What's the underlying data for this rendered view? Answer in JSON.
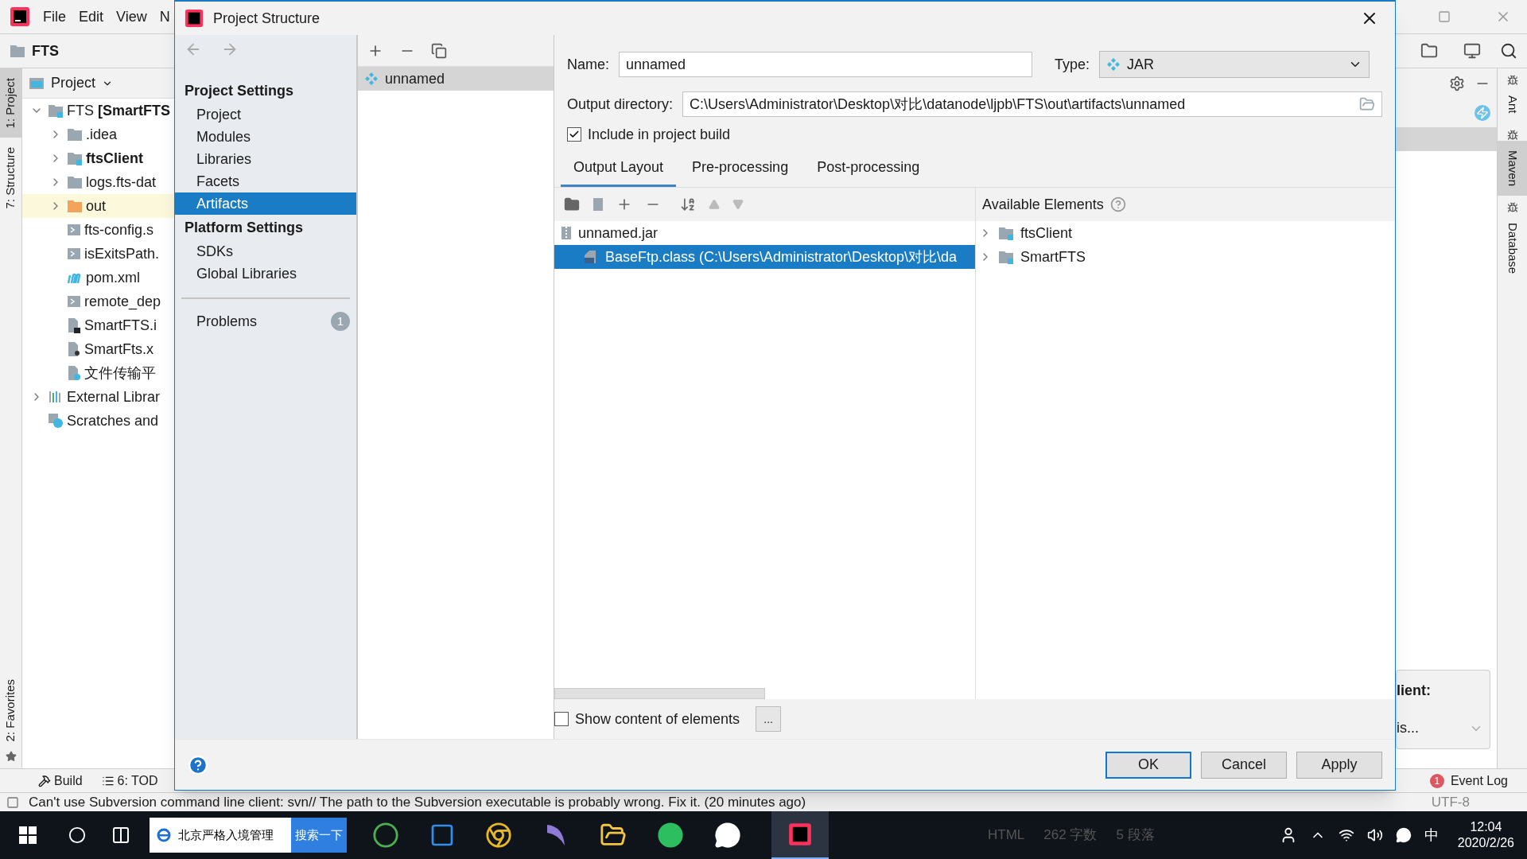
{
  "ide": {
    "menu": [
      "File",
      "Edit",
      "View",
      "N"
    ],
    "breadcrumb": "FTS",
    "left_stripe": [
      {
        "label": "1: Project",
        "selected": true
      },
      {
        "label": "7: Structure",
        "selected": false
      }
    ],
    "left_stripe_bottom": [
      {
        "label": "2: Favorites",
        "selected": false
      }
    ],
    "project_panel": {
      "title": "Project",
      "tree": [
        {
          "label": "FTS **[SmartFTS**",
          "kind": "module-folder",
          "expanded": true,
          "highlighted": false,
          "bold": false,
          "children": [
            {
              "label": ".idea",
              "kind": "folder",
              "expanded": false,
              "highlighted": false,
              "bold": false
            },
            {
              "label": "ftsClient",
              "kind": "module-folder",
              "expanded": false,
              "highlighted": false,
              "bold": true
            },
            {
              "label": "logs.fts-dat",
              "kind": "folder",
              "expanded": false,
              "highlighted": false,
              "bold": false
            },
            {
              "label": "out",
              "kind": "excluded-folder",
              "expanded": false,
              "highlighted": true,
              "bold": false
            },
            {
              "label": "fts-config.s",
              "kind": "text-file",
              "highlighted": false,
              "bold": false
            },
            {
              "label": "isExitsPath.",
              "kind": "text-file",
              "highlighted": false,
              "bold": false
            },
            {
              "label": "pom.xml",
              "kind": "maven-file",
              "highlighted": false,
              "bold": false
            },
            {
              "label": "remote_dep",
              "kind": "text-file",
              "highlighted": false,
              "bold": false
            },
            {
              "label": "SmartFTS.i",
              "kind": "module-file",
              "highlighted": false,
              "bold": false
            },
            {
              "label": "SmartFts.x",
              "kind": "config-file",
              "highlighted": false,
              "bold": false
            },
            {
              "label": "文件传输平",
              "kind": "unknown-file",
              "highlighted": false,
              "bold": false
            }
          ]
        },
        {
          "label": "External Librar",
          "kind": "library",
          "expanded": false,
          "highlighted": false,
          "bold": false
        },
        {
          "label": "Scratches and",
          "kind": "scratches",
          "highlighted": false,
          "bold": false
        }
      ]
    },
    "right_popup": {
      "title": "lient:",
      "value": "is..."
    },
    "right_stripe": [
      {
        "label": "Ant",
        "selected": false
      },
      {
        "label": "Maven",
        "selected": true
      },
      {
        "label": "Database",
        "selected": false
      }
    ],
    "bottom_tools": [
      "Build",
      "6: TOD"
    ],
    "event_log": {
      "label": "Event Log",
      "count": "1"
    },
    "status": {
      "message": "Can't use Subversion command line client: svn// The path to the Subversion executable is probably wrong. Fix it. (20 minutes ago)",
      "encoding": "UTF-8"
    }
  },
  "dialog": {
    "title": "Project Structure",
    "sections": [
      {
        "heading": "Project Settings",
        "items": [
          {
            "label": "Project",
            "selected": false
          },
          {
            "label": "Modules",
            "selected": false
          },
          {
            "label": "Libraries",
            "selected": false
          },
          {
            "label": "Facets",
            "selected": false
          },
          {
            "label": "Artifacts",
            "selected": true
          }
        ]
      },
      {
        "heading": "Platform Settings",
        "items": [
          {
            "label": "SDKs",
            "selected": false
          },
          {
            "label": "Global Libraries",
            "selected": false
          }
        ]
      }
    ],
    "problems": {
      "label": "Problems",
      "count": "1"
    },
    "artifacts": [
      {
        "label": "unnamed",
        "selected": true
      }
    ],
    "name": {
      "label": "Name:",
      "value": "unnamed"
    },
    "type": {
      "label": "Type:",
      "value": "JAR"
    },
    "output": {
      "label": "Output directory:",
      "value": "C:\\Users\\Administrator\\Desktop\\对比\\datanode\\ljpb\\FTS\\out\\artifacts\\unnamed"
    },
    "include": {
      "label": "Include in project build",
      "checked": true
    },
    "tabs": [
      {
        "label": "Output Layout",
        "selected": true
      },
      {
        "label": "Pre-processing",
        "selected": false
      },
      {
        "label": "Post-processing",
        "selected": false
      }
    ],
    "layout_tree": [
      {
        "label": "unnamed.jar",
        "kind": "jar",
        "selected": false,
        "children": [
          {
            "label": "BaseFtp.class (C:\\Users\\Administrator\\Desktop\\对比\\da",
            "kind": "class",
            "selected": true
          }
        ]
      }
    ],
    "available": {
      "title": "Available Elements",
      "items": [
        {
          "label": "ftsClient",
          "expanded": false
        },
        {
          "label": "SmartFTS",
          "expanded": false
        }
      ]
    },
    "show_content": {
      "label": "Show content of elements",
      "checked": false
    },
    "more_button": "...",
    "buttons": [
      {
        "label": "OK",
        "kind": "default"
      },
      {
        "label": "Cancel",
        "kind": "normal"
      },
      {
        "label": "Apply",
        "kind": "normal"
      }
    ]
  },
  "taskbar": {
    "search_app": "北京严格入境管理",
    "search_button": "搜索一下",
    "background_texts": [
      "HTML",
      "262 字数",
      "5 段落"
    ],
    "ime": "中",
    "time": "12:04",
    "date": "2020/2/26"
  }
}
